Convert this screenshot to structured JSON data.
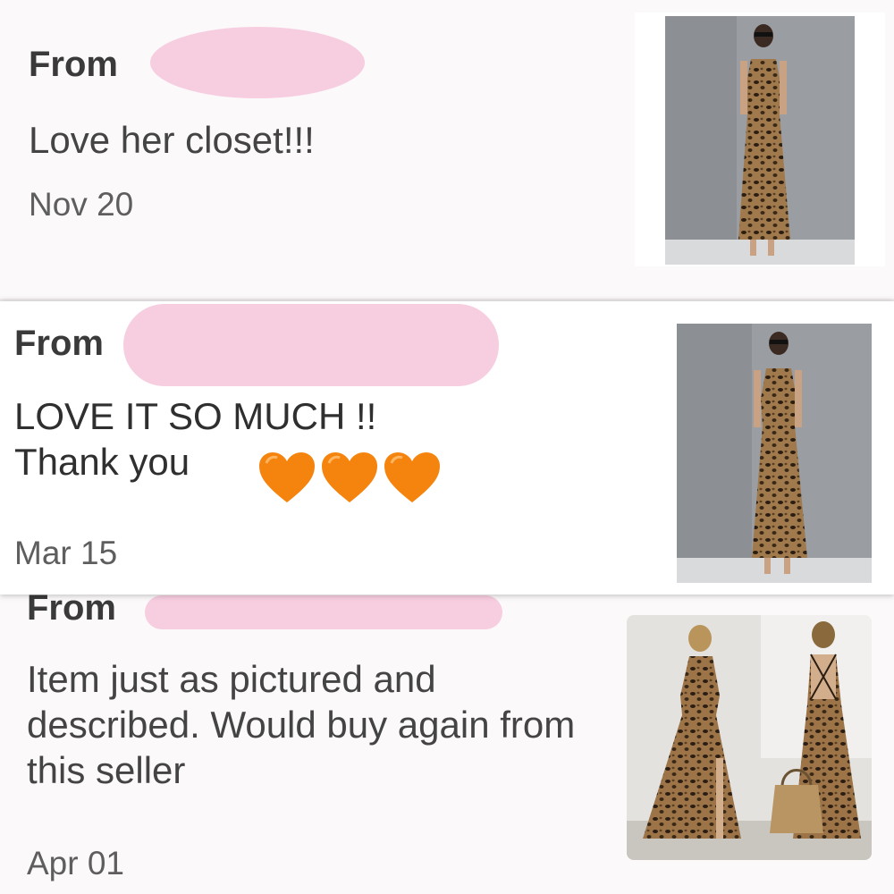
{
  "reviews": [
    {
      "from_label": "From",
      "message": "Love her closet!!!",
      "date": "Nov 20",
      "photo": "model-in-leopard-maxi-dress-gray-wall"
    },
    {
      "from_label": "From",
      "message": "LOVE IT SO MUCH !!\nThank you",
      "emoji": [
        "orange-heart-icon",
        "orange-heart-icon",
        "orange-heart-icon"
      ],
      "date": "Mar 15",
      "photo": "model-in-leopard-maxi-dress-gray-wall"
    },
    {
      "from_label": "From",
      "message": "Item just as pictured and described. Would buy again from this seller",
      "date": "Apr 01",
      "photo": "leopard-maxi-dress-front-and-back-views"
    }
  ],
  "colors": {
    "redaction": "#f7cde0",
    "heart": "#f5840f",
    "text": "#444444"
  }
}
